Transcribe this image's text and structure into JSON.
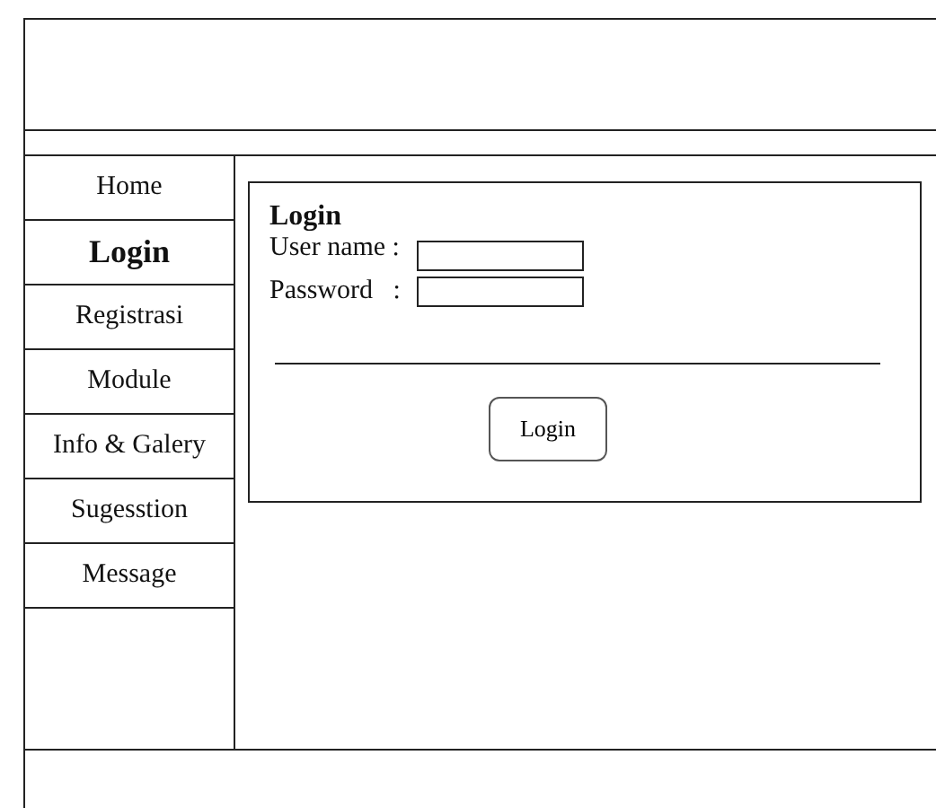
{
  "nav": {
    "items": [
      {
        "label": "Home",
        "selected": false
      },
      {
        "label": "Login",
        "selected": true
      },
      {
        "label": "Registrasi",
        "selected": false
      },
      {
        "label": "Module",
        "selected": false
      },
      {
        "label": "Info & Galery",
        "selected": false
      },
      {
        "label": "Sugesstion",
        "selected": false
      },
      {
        "label": "Message",
        "selected": false
      }
    ]
  },
  "login": {
    "title": "Login",
    "username_label": "User name :",
    "password_label": "Password   :",
    "button": "Login"
  }
}
